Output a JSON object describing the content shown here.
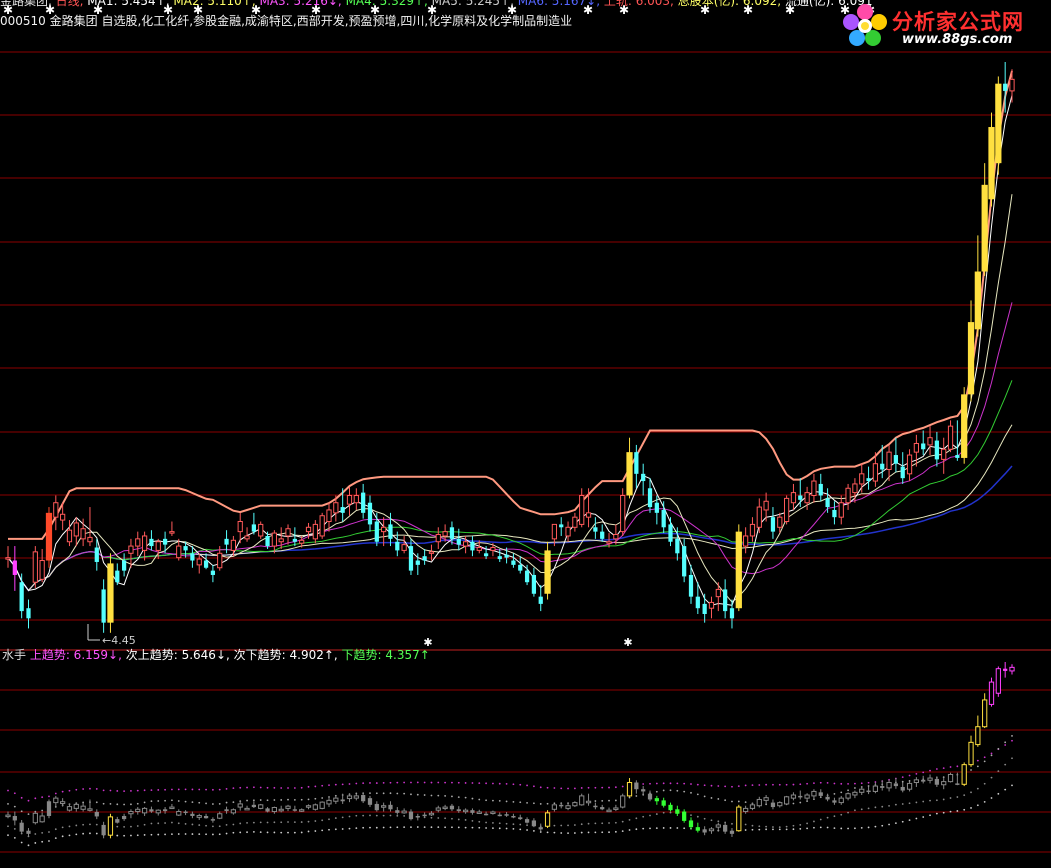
{
  "header": {
    "items": [
      {
        "text": "金路集团",
        "color": "#e0e0e0"
      },
      {
        "text": "日线",
        "color": "#ff5555"
      },
      {
        "text": "MA1: 5.454↑",
        "color": "#ffffff"
      },
      {
        "text": "MA2: 5.110↑",
        "color": "#ffff66"
      },
      {
        "text": "MA3: 5.216↓",
        "color": "#ff55ff"
      },
      {
        "text": "MA4: 5.329↑",
        "color": "#55ff55"
      },
      {
        "text": "MA5: 5.245↑",
        "color": "#cccccc"
      },
      {
        "text": "MA6: 5.167↓",
        "color": "#5566ff"
      },
      {
        "text": "上轨: 6.003",
        "color": "#ff5555"
      },
      {
        "text": "总股本(亿): 6.092",
        "color": "#ffff66"
      },
      {
        "text": "流通(亿): 6.091",
        "color": "#ffffff"
      }
    ]
  },
  "stock_info": "000510 金路集团 自选股,化工化纤,参股金融,成渝特区,西部开发,预盈预增,四川,化学原料及化学制品制造业",
  "indicator_header": {
    "name": "水手",
    "items": [
      {
        "text": "上趋势: 6.159↓",
        "color": "#ff55ff"
      },
      {
        "text": "次上趋势: 5.646↓",
        "color": "#ffffff"
      },
      {
        "text": "次下趋势: 4.902↑",
        "color": "#ffffff"
      },
      {
        "text": "下趋势: 4.357↑",
        "color": "#55ff55"
      }
    ]
  },
  "low_label": "4.45",
  "logo": {
    "text": "分析家公式网",
    "url": "www.88gs.com"
  },
  "colors": {
    "up": "#ff5a5a",
    "down": "#55ffff",
    "yellow": "#ffe040",
    "magenta": "#ff40ff",
    "orange": "#ff4a2a",
    "band": "#ff9980",
    "ma_white": "#ffffff",
    "ma_magenta": "#cc33cc",
    "ma_green": "#33cc33",
    "ma_cream": "#e8e8c0",
    "ma_blue": "#2233cc",
    "grid": "#8b0000"
  },
  "chart_data": {
    "type": "candlestick",
    "series_note": "",
    "candles": [
      {
        "o": 4.96,
        "h": 5.05,
        "l": 4.9,
        "c": 4.97
      },
      {
        "o": 4.95,
        "h": 5.05,
        "l": 4.74,
        "c": 4.85
      },
      {
        "o": 4.8,
        "h": 4.86,
        "l": 4.55,
        "c": 4.6
      },
      {
        "o": 4.62,
        "h": 4.68,
        "l": 4.48,
        "c": 4.55
      },
      {
        "o": 4.8,
        "h": 5.05,
        "l": 4.76,
        "c": 5.01
      },
      {
        "o": 4.82,
        "h": 5.03,
        "l": 4.8,
        "c": 4.95
      },
      {
        "o": 5.28,
        "h": 5.32,
        "l": 4.9,
        "c": 4.95
      },
      {
        "o": 5.25,
        "h": 5.4,
        "l": 5.16,
        "c": 5.35
      },
      {
        "o": 5.23,
        "h": 5.35,
        "l": 5.16,
        "c": 5.27
      },
      {
        "o": 5.08,
        "h": 5.23,
        "l": 5.05,
        "c": 5.16
      },
      {
        "o": 5.12,
        "h": 5.25,
        "l": 5.05,
        "c": 5.21
      },
      {
        "o": 5.1,
        "h": 5.24,
        "l": 5.05,
        "c": 5.17
      },
      {
        "o": 5.08,
        "h": 5.32,
        "l": 5.05,
        "c": 5.11
      },
      {
        "o": 5.04,
        "h": 5.1,
        "l": 4.88,
        "c": 4.94
      },
      {
        "o": 4.75,
        "h": 4.82,
        "l": 4.45,
        "c": 4.52
      },
      {
        "o": 4.52,
        "h": 5.0,
        "l": 4.45,
        "c": 4.93
      },
      {
        "o": 4.88,
        "h": 4.93,
        "l": 4.78,
        "c": 4.8
      },
      {
        "o": 4.95,
        "h": 5.0,
        "l": 4.84,
        "c": 4.88
      },
      {
        "o": 5.0,
        "h": 5.1,
        "l": 4.9,
        "c": 5.05
      },
      {
        "o": 5.05,
        "h": 5.15,
        "l": 4.98,
        "c": 5.1
      },
      {
        "o": 5.02,
        "h": 5.15,
        "l": 4.95,
        "c": 5.12
      },
      {
        "o": 5.1,
        "h": 5.16,
        "l": 5.02,
        "c": 5.05
      },
      {
        "o": 5.02,
        "h": 5.1,
        "l": 4.96,
        "c": 5.08
      },
      {
        "o": 5.1,
        "h": 5.15,
        "l": 5.0,
        "c": 5.06
      },
      {
        "o": 5.14,
        "h": 5.22,
        "l": 5.12,
        "c": 5.15
      },
      {
        "o": 4.97,
        "h": 5.1,
        "l": 4.95,
        "c": 5.05
      },
      {
        "o": 5.05,
        "h": 5.08,
        "l": 4.97,
        "c": 5.02
      },
      {
        "o": 5.0,
        "h": 5.05,
        "l": 4.9,
        "c": 4.95
      },
      {
        "o": 4.92,
        "h": 5.0,
        "l": 4.86,
        "c": 4.96
      },
      {
        "o": 4.95,
        "h": 5.0,
        "l": 4.89,
        "c": 4.9
      },
      {
        "o": 4.88,
        "h": 4.92,
        "l": 4.8,
        "c": 4.85
      },
      {
        "o": 4.9,
        "h": 5.05,
        "l": 4.88,
        "c": 5.0
      },
      {
        "o": 5.1,
        "h": 5.16,
        "l": 5.0,
        "c": 5.06
      },
      {
        "o": 5.02,
        "h": 5.12,
        "l": 4.98,
        "c": 5.09
      },
      {
        "o": 5.15,
        "h": 5.28,
        "l": 5.07,
        "c": 5.22
      },
      {
        "o": 5.1,
        "h": 5.18,
        "l": 5.08,
        "c": 5.12
      },
      {
        "o": 5.2,
        "h": 5.28,
        "l": 5.13,
        "c": 5.15
      },
      {
        "o": 5.12,
        "h": 5.22,
        "l": 5.1,
        "c": 5.2
      },
      {
        "o": 5.12,
        "h": 5.15,
        "l": 5.03,
        "c": 5.05
      },
      {
        "o": 5.05,
        "h": 5.16,
        "l": 5.0,
        "c": 5.14
      },
      {
        "o": 5.08,
        "h": 5.18,
        "l": 5.03,
        "c": 5.1
      },
      {
        "o": 5.12,
        "h": 5.2,
        "l": 5.06,
        "c": 5.17
      },
      {
        "o": 5.1,
        "h": 5.18,
        "l": 5.05,
        "c": 5.08
      },
      {
        "o": 5.07,
        "h": 5.12,
        "l": 5.04,
        "c": 5.09
      },
      {
        "o": 5.15,
        "h": 5.21,
        "l": 5.1,
        "c": 5.18
      },
      {
        "o": 5.1,
        "h": 5.23,
        "l": 5.07,
        "c": 5.2
      },
      {
        "o": 5.12,
        "h": 5.28,
        "l": 5.1,
        "c": 5.26
      },
      {
        "o": 5.22,
        "h": 5.35,
        "l": 5.15,
        "c": 5.3
      },
      {
        "o": 5.28,
        "h": 5.4,
        "l": 5.22,
        "c": 5.35
      },
      {
        "o": 5.32,
        "h": 5.45,
        "l": 5.22,
        "c": 5.28
      },
      {
        "o": 5.34,
        "h": 5.46,
        "l": 5.26,
        "c": 5.4
      },
      {
        "o": 5.35,
        "h": 5.45,
        "l": 5.3,
        "c": 5.4
      },
      {
        "o": 5.42,
        "h": 5.48,
        "l": 5.24,
        "c": 5.28
      },
      {
        "o": 5.35,
        "h": 5.4,
        "l": 5.15,
        "c": 5.2
      },
      {
        "o": 5.22,
        "h": 5.28,
        "l": 5.05,
        "c": 5.08
      },
      {
        "o": 5.15,
        "h": 5.25,
        "l": 5.05,
        "c": 5.18
      },
      {
        "o": 5.2,
        "h": 5.28,
        "l": 5.05,
        "c": 5.1
      },
      {
        "o": 5.08,
        "h": 5.15,
        "l": 4.98,
        "c": 5.02
      },
      {
        "o": 5.02,
        "h": 5.12,
        "l": 5.0,
        "c": 5.06
      },
      {
        "o": 5.05,
        "h": 5.1,
        "l": 4.85,
        "c": 4.88
      },
      {
        "o": 4.95,
        "h": 5.0,
        "l": 4.85,
        "c": 4.92
      },
      {
        "o": 4.98,
        "h": 5.03,
        "l": 4.92,
        "c": 4.95
      },
      {
        "o": 5.0,
        "h": 5.06,
        "l": 4.95,
        "c": 5.01
      },
      {
        "o": 5.08,
        "h": 5.18,
        "l": 5.03,
        "c": 5.13
      },
      {
        "o": 5.12,
        "h": 5.2,
        "l": 5.08,
        "c": 5.15
      },
      {
        "o": 5.18,
        "h": 5.22,
        "l": 5.06,
        "c": 5.1
      },
      {
        "o": 5.1,
        "h": 5.17,
        "l": 5.02,
        "c": 5.06
      },
      {
        "o": 5.05,
        "h": 5.12,
        "l": 5.0,
        "c": 5.08
      },
      {
        "o": 5.08,
        "h": 5.12,
        "l": 4.98,
        "c": 5.02
      },
      {
        "o": 5.02,
        "h": 5.09,
        "l": 5.0,
        "c": 5.04
      },
      {
        "o": 5.0,
        "h": 5.05,
        "l": 4.96,
        "c": 4.98
      },
      {
        "o": 5.02,
        "h": 5.07,
        "l": 4.98,
        "c": 5.04
      },
      {
        "o": 4.98,
        "h": 5.03,
        "l": 4.94,
        "c": 4.96
      },
      {
        "o": 4.99,
        "h": 5.04,
        "l": 4.93,
        "c": 4.97
      },
      {
        "o": 4.95,
        "h": 5.0,
        "l": 4.9,
        "c": 4.92
      },
      {
        "o": 4.92,
        "h": 4.98,
        "l": 4.86,
        "c": 4.88
      },
      {
        "o": 4.88,
        "h": 4.92,
        "l": 4.78,
        "c": 4.8
      },
      {
        "o": 4.85,
        "h": 4.9,
        "l": 4.7,
        "c": 4.72
      },
      {
        "o": 4.7,
        "h": 4.78,
        "l": 4.6,
        "c": 4.65
      },
      {
        "o": 4.72,
        "h": 5.08,
        "l": 4.68,
        "c": 5.02
      },
      {
        "o": 5.1,
        "h": 5.2,
        "l": 5.05,
        "c": 5.2
      },
      {
        "o": 5.2,
        "h": 5.25,
        "l": 5.12,
        "c": 5.18
      },
      {
        "o": 5.12,
        "h": 5.22,
        "l": 5.08,
        "c": 5.18
      },
      {
        "o": 5.18,
        "h": 5.28,
        "l": 5.15,
        "c": 5.25
      },
      {
        "o": 5.2,
        "h": 5.45,
        "l": 5.18,
        "c": 5.4
      },
      {
        "o": 5.25,
        "h": 5.45,
        "l": 5.18,
        "c": 5.28
      },
      {
        "o": 5.18,
        "h": 5.25,
        "l": 5.1,
        "c": 5.15
      },
      {
        "o": 5.15,
        "h": 5.2,
        "l": 5.08,
        "c": 5.1
      },
      {
        "o": 5.08,
        "h": 5.14,
        "l": 5.04,
        "c": 5.08
      },
      {
        "o": 5.1,
        "h": 5.2,
        "l": 5.06,
        "c": 5.13
      },
      {
        "o": 5.15,
        "h": 5.45,
        "l": 5.12,
        "c": 5.4
      },
      {
        "o": 5.4,
        "h": 5.8,
        "l": 5.38,
        "c": 5.7
      },
      {
        "o": 5.7,
        "h": 5.75,
        "l": 5.45,
        "c": 5.55
      },
      {
        "o": 5.55,
        "h": 5.62,
        "l": 5.4,
        "c": 5.5
      },
      {
        "o": 5.45,
        "h": 5.52,
        "l": 5.28,
        "c": 5.32
      },
      {
        "o": 5.35,
        "h": 5.4,
        "l": 5.2,
        "c": 5.28
      },
      {
        "o": 5.3,
        "h": 5.36,
        "l": 5.14,
        "c": 5.18
      },
      {
        "o": 5.2,
        "h": 5.25,
        "l": 5.05,
        "c": 5.08
      },
      {
        "o": 5.1,
        "h": 5.18,
        "l": 4.95,
        "c": 5.0
      },
      {
        "o": 5.05,
        "h": 5.1,
        "l": 4.8,
        "c": 4.84
      },
      {
        "o": 4.85,
        "h": 4.92,
        "l": 4.65,
        "c": 4.7
      },
      {
        "o": 4.7,
        "h": 4.8,
        "l": 4.58,
        "c": 4.62
      },
      {
        "o": 4.65,
        "h": 4.72,
        "l": 4.52,
        "c": 4.58
      },
      {
        "o": 4.62,
        "h": 4.7,
        "l": 4.55,
        "c": 4.66
      },
      {
        "o": 4.7,
        "h": 4.8,
        "l": 4.6,
        "c": 4.75
      },
      {
        "o": 4.75,
        "h": 4.82,
        "l": 4.55,
        "c": 4.6
      },
      {
        "o": 4.62,
        "h": 4.68,
        "l": 4.48,
        "c": 4.55
      },
      {
        "o": 4.62,
        "h": 5.2,
        "l": 4.6,
        "c": 5.15
      },
      {
        "o": 5.05,
        "h": 5.18,
        "l": 5.0,
        "c": 5.12
      },
      {
        "o": 5.12,
        "h": 5.25,
        "l": 5.08,
        "c": 5.2
      },
      {
        "o": 5.18,
        "h": 5.38,
        "l": 5.14,
        "c": 5.32
      },
      {
        "o": 5.3,
        "h": 5.42,
        "l": 5.22,
        "c": 5.36
      },
      {
        "o": 5.25,
        "h": 5.32,
        "l": 5.1,
        "c": 5.15
      },
      {
        "o": 5.18,
        "h": 5.28,
        "l": 5.14,
        "c": 5.25
      },
      {
        "o": 5.22,
        "h": 5.4,
        "l": 5.2,
        "c": 5.38
      },
      {
        "o": 5.35,
        "h": 5.48,
        "l": 5.3,
        "c": 5.42
      },
      {
        "o": 5.4,
        "h": 5.52,
        "l": 5.32,
        "c": 5.37
      },
      {
        "o": 5.35,
        "h": 5.46,
        "l": 5.3,
        "c": 5.42
      },
      {
        "o": 5.4,
        "h": 5.55,
        "l": 5.35,
        "c": 5.5
      },
      {
        "o": 5.48,
        "h": 5.55,
        "l": 5.36,
        "c": 5.4
      },
      {
        "o": 5.38,
        "h": 5.45,
        "l": 5.28,
        "c": 5.32
      },
      {
        "o": 5.3,
        "h": 5.36,
        "l": 5.2,
        "c": 5.25
      },
      {
        "o": 5.25,
        "h": 5.4,
        "l": 5.2,
        "c": 5.35
      },
      {
        "o": 5.35,
        "h": 5.48,
        "l": 5.3,
        "c": 5.45
      },
      {
        "o": 5.42,
        "h": 5.52,
        "l": 5.35,
        "c": 5.48
      },
      {
        "o": 5.48,
        "h": 5.62,
        "l": 5.42,
        "c": 5.55
      },
      {
        "o": 5.52,
        "h": 5.6,
        "l": 5.44,
        "c": 5.5
      },
      {
        "o": 5.5,
        "h": 5.7,
        "l": 5.46,
        "c": 5.62
      },
      {
        "o": 5.62,
        "h": 5.75,
        "l": 5.52,
        "c": 5.58
      },
      {
        "o": 5.58,
        "h": 5.75,
        "l": 5.5,
        "c": 5.7
      },
      {
        "o": 5.68,
        "h": 5.8,
        "l": 5.56,
        "c": 5.62
      },
      {
        "o": 5.6,
        "h": 5.7,
        "l": 5.48,
        "c": 5.52
      },
      {
        "o": 5.55,
        "h": 5.72,
        "l": 5.5,
        "c": 5.68
      },
      {
        "o": 5.7,
        "h": 5.82,
        "l": 5.6,
        "c": 5.76
      },
      {
        "o": 5.76,
        "h": 5.85,
        "l": 5.68,
        "c": 5.72
      },
      {
        "o": 5.75,
        "h": 5.88,
        "l": 5.68,
        "c": 5.8
      },
      {
        "o": 5.78,
        "h": 5.84,
        "l": 5.6,
        "c": 5.65
      },
      {
        "o": 5.65,
        "h": 5.8,
        "l": 5.55,
        "c": 5.72
      },
      {
        "o": 5.72,
        "h": 5.92,
        "l": 5.7,
        "c": 5.88
      },
      {
        "o": 5.68,
        "h": 5.92,
        "l": 5.64,
        "c": 5.66
      },
      {
        "o": 5.66,
        "h": 6.15,
        "l": 5.62,
        "c": 6.1
      },
      {
        "o": 6.1,
        "h": 6.75,
        "l": 6.05,
        "c": 6.6
      },
      {
        "o": 6.55,
        "h": 7.2,
        "l": 6.5,
        "c": 6.95
      },
      {
        "o": 6.95,
        "h": 7.7,
        "l": 6.92,
        "c": 7.55
      },
      {
        "o": 7.45,
        "h": 8.05,
        "l": 7.4,
        "c": 7.95
      },
      {
        "o": 7.7,
        "h": 8.3,
        "l": 7.62,
        "c": 8.25
      },
      {
        "o": 8.25,
        "h": 8.4,
        "l": 8.05,
        "c": 8.2
      },
      {
        "o": 8.2,
        "h": 8.35,
        "l": 8.12,
        "c": 8.28
      }
    ],
    "oscillator": {
      "name": "水手",
      "upper_trend": 6.159,
      "upper_secondary": 5.646,
      "lower_secondary": 4.902,
      "lower_trend": 4.357
    }
  }
}
